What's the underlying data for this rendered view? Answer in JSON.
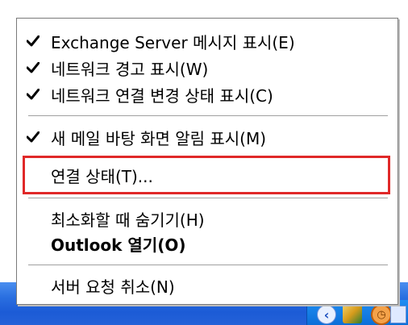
{
  "menu": {
    "items": [
      {
        "label": "Exchange Server 메시지 표시(E)",
        "checked": true
      },
      {
        "label": "네트워크 경고 표시(W)",
        "checked": true
      },
      {
        "label": "네트워크 연결 변경 상태 표시(C)",
        "checked": true
      },
      {
        "label": "새 메일 바탕 화면 알림 표시(M)",
        "checked": true
      },
      {
        "label": "연결 상태(T)...",
        "checked": false,
        "highlighted": true
      },
      {
        "label": "최소화할 때 숨기기(H)",
        "checked": false
      },
      {
        "label": "Outlook 열기(O)",
        "checked": false,
        "bold": true
      },
      {
        "label": "서버 요청 취소(N)",
        "checked": false
      }
    ]
  },
  "colors": {
    "highlight_border": "#e02828",
    "taskbar_blue": "#2462d8"
  },
  "icons": {
    "check": "check-icon",
    "tray_show_hidden": "chevron-left-icon",
    "outlook_tray": "outlook-icon",
    "clock": "clock-icon"
  }
}
